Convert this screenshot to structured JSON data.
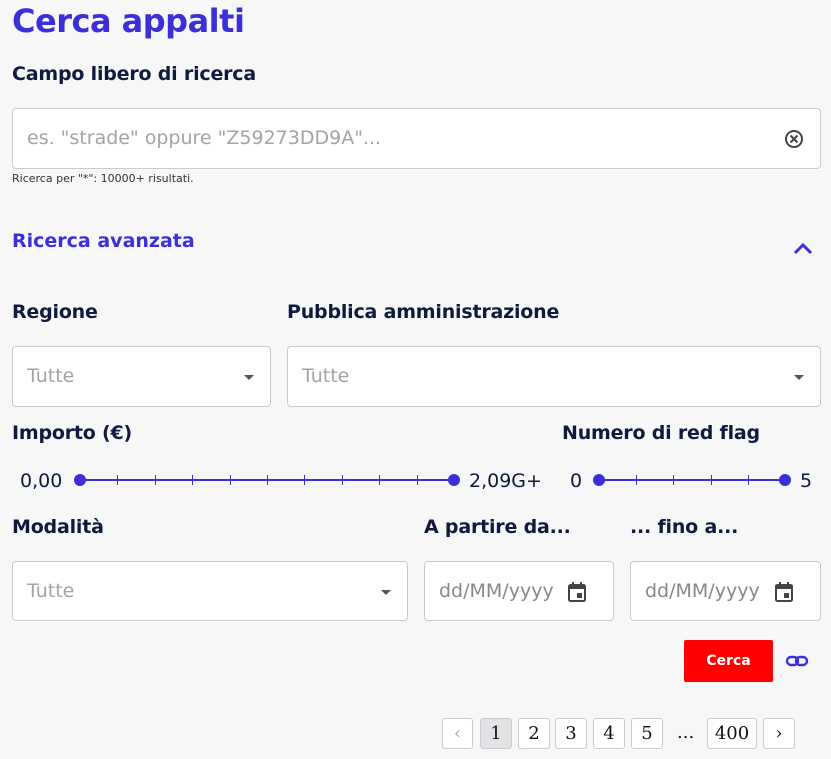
{
  "page": {
    "title": "Cerca appalti"
  },
  "search": {
    "label": "Campo libero di ricerca",
    "placeholder": "es. \"strade\" oppure \"Z59273DD9A\"...",
    "hint": "Ricerca per \"*\": 10000+ risultati."
  },
  "advanced": {
    "title": "Ricerca avanzata",
    "regione": {
      "label": "Regione",
      "value": "Tutte"
    },
    "pa": {
      "label": "Pubblica amministrazione",
      "value": "Tutte"
    },
    "importo": {
      "label": "Importo (€)",
      "min": "0,00",
      "max": "2,09G+",
      "range_fraction": [
        0,
        1
      ]
    },
    "redflag": {
      "label": "Numero di red flag",
      "min": "0",
      "max": "5",
      "range_fraction": [
        0,
        1
      ]
    },
    "modalita": {
      "label": "Modalità",
      "value": "Tutte"
    },
    "from": {
      "label": "A partire da...",
      "placeholder": "dd/MM/yyyy"
    },
    "to": {
      "label": "... fino a...",
      "placeholder": "dd/MM/yyyy"
    }
  },
  "actions": {
    "search_label": "Cerca"
  },
  "pagination": {
    "prev": "‹",
    "pages": [
      "1",
      "2",
      "3",
      "4",
      "5"
    ],
    "ellipsis": "...",
    "last": "400",
    "next": "›",
    "current": "1"
  },
  "colors": {
    "accent": "#3b2fd9",
    "button": "#ff0000",
    "text": "#0e1b3d"
  }
}
